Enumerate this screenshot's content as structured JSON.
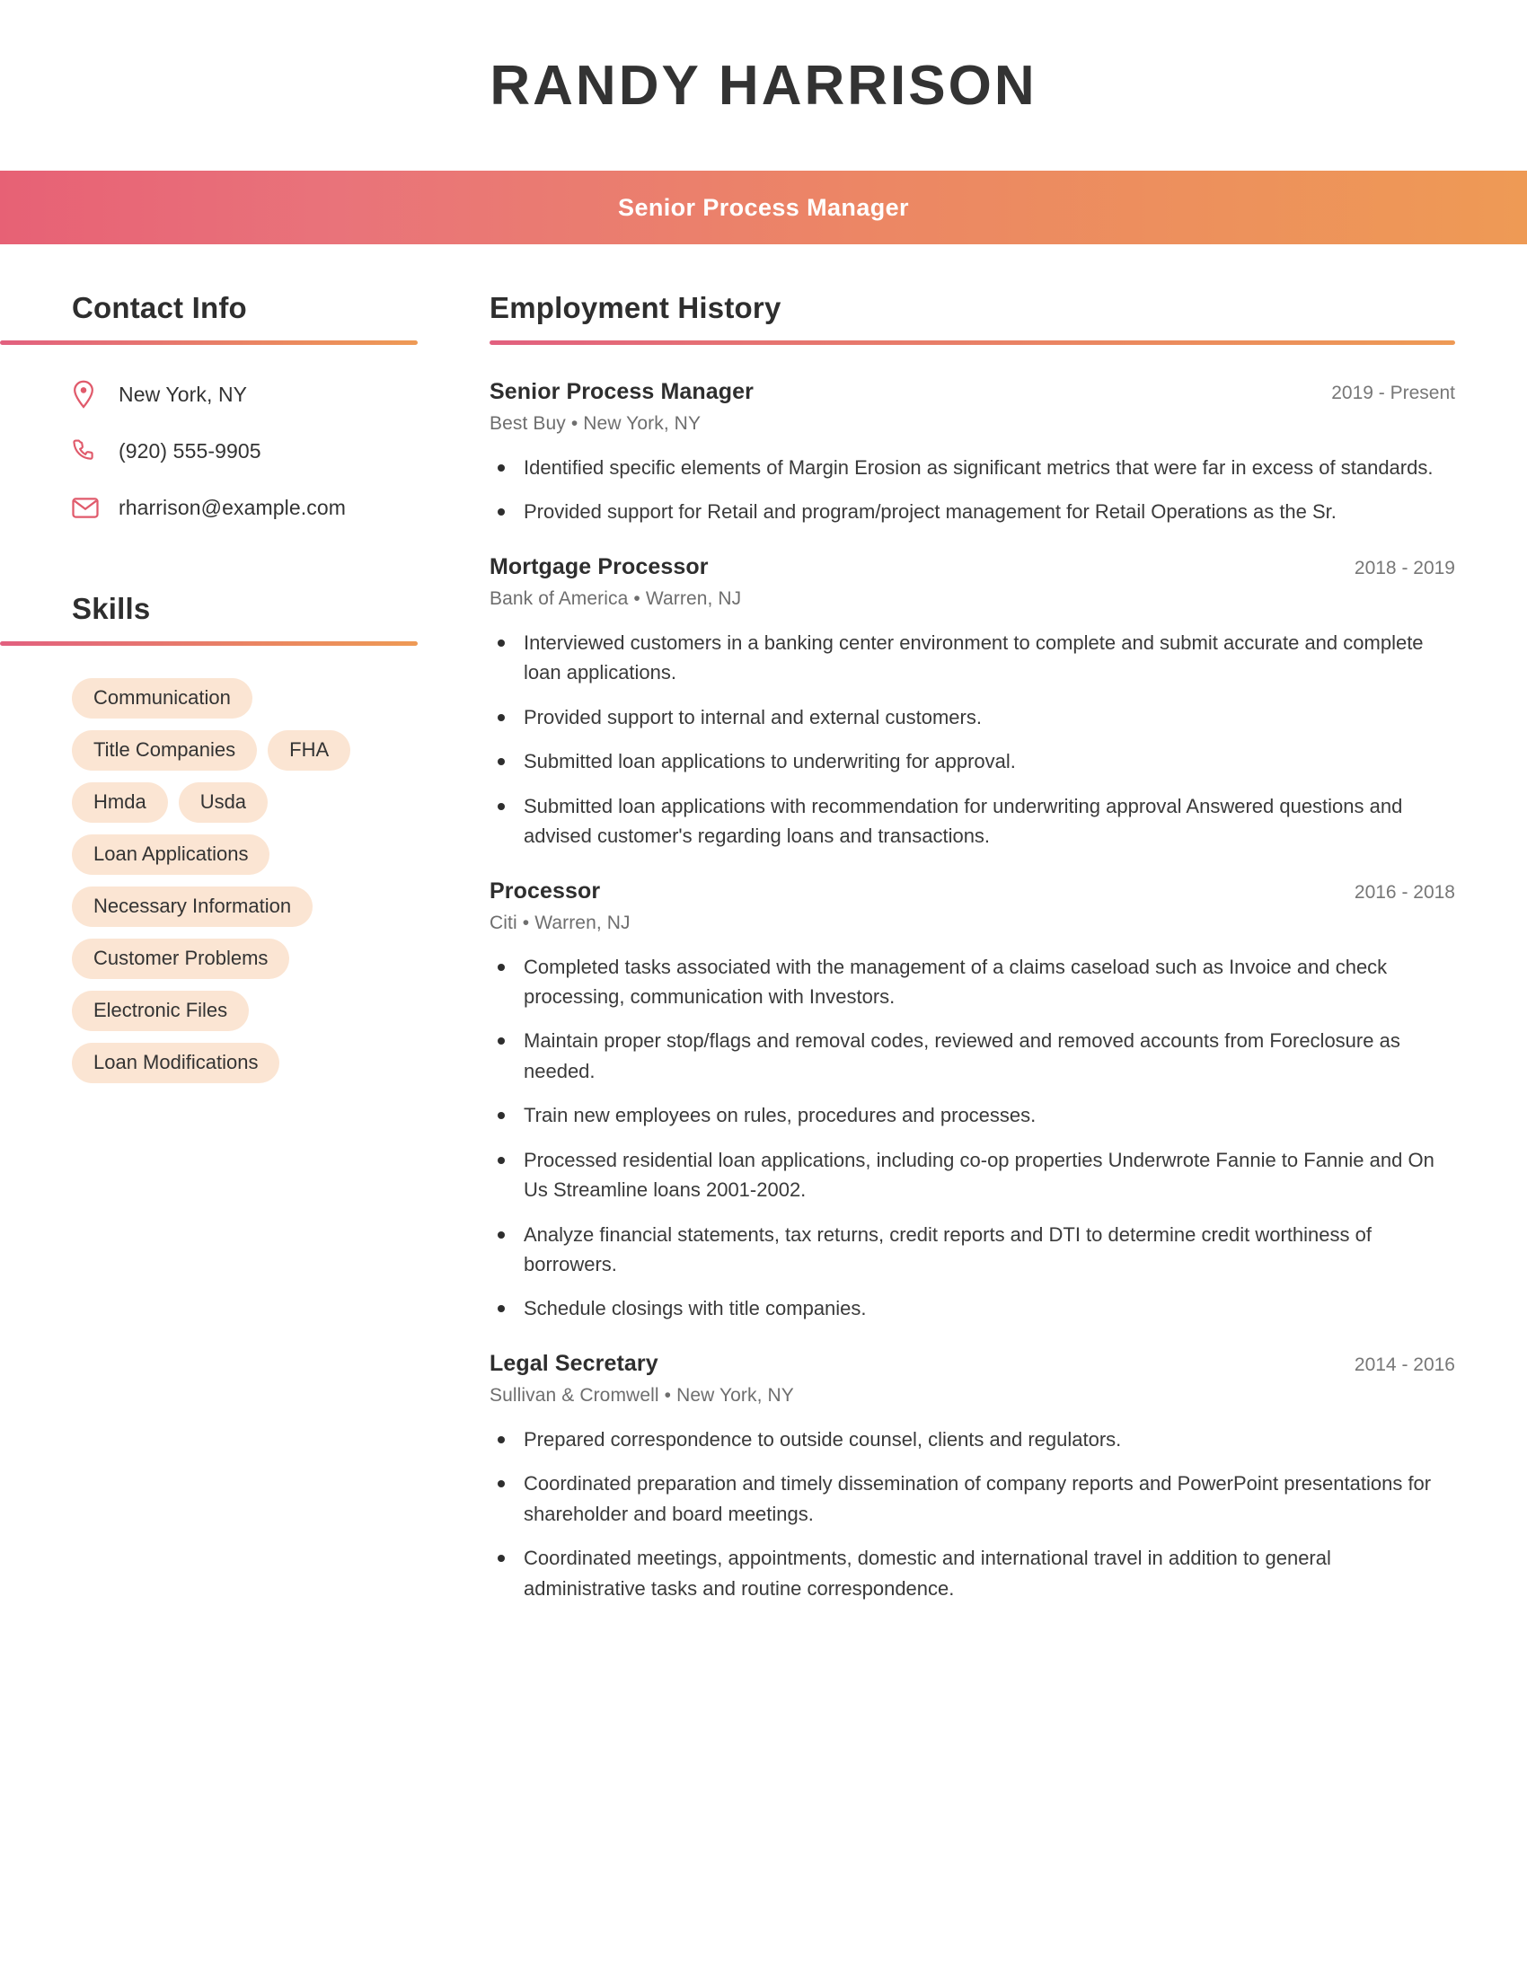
{
  "header": {
    "name": "RANDY HARRISON",
    "job_title": "Senior Process Manager",
    "gradient_start": "#E76175",
    "gradient_end": "#EE9A55"
  },
  "sidebar": {
    "contact": {
      "heading": "Contact Info",
      "items": [
        {
          "icon": "location-pin-icon",
          "value": "New York, NY"
        },
        {
          "icon": "phone-icon",
          "value": "(920) 555-9905"
        },
        {
          "icon": "envelope-icon",
          "value": "rharrison@example.com"
        }
      ]
    },
    "skills": {
      "heading": "Skills",
      "pill_background": "#FBE5D3",
      "items": [
        "Communication",
        "Title Companies",
        "FHA",
        "Hmda",
        "Usda",
        "Loan Applications",
        "Necessary Information",
        "Customer Problems",
        "Electronic Files",
        "Loan Modifications"
      ]
    }
  },
  "main": {
    "heading": "Employment History",
    "jobs": [
      {
        "title": "Senior Process Manager",
        "dates": "2019 - Present",
        "company": "Best Buy",
        "location": "New York, NY",
        "bullets": [
          "Identified specific elements of Margin Erosion as significant metrics that were far in excess of standards.",
          "Provided support for Retail and program/project management for Retail Operations as the Sr."
        ]
      },
      {
        "title": "Mortgage Processor",
        "dates": "2018 - 2019",
        "company": "Bank of America",
        "location": "Warren, NJ",
        "bullets": [
          "Interviewed customers in a banking center environment to complete and submit accurate and complete loan applications.",
          "Provided support to internal and external customers.",
          "Submitted loan applications to underwriting for approval.",
          "Submitted loan applications with recommendation for underwriting approval Answered questions and advised customer's regarding loans and transactions."
        ]
      },
      {
        "title": "Processor",
        "dates": "2016 - 2018",
        "company": "Citi",
        "location": "Warren, NJ",
        "bullets": [
          "Completed tasks associated with the management of a claims caseload such as Invoice and check processing, communication with Investors.",
          "Maintain proper stop/flags and removal codes, reviewed and removed accounts from Foreclosure as needed.",
          "Train new employees on rules, procedures and processes.",
          "Processed residential loan applications, including co-op properties Underwrote Fannie to Fannie and On Us Streamline loans 2001-2002.",
          "Analyze financial statements, tax returns, credit reports and DTI to determine credit worthiness of borrowers.",
          "Schedule closings with title companies."
        ]
      },
      {
        "title": "Legal Secretary",
        "dates": "2014 - 2016",
        "company": "Sullivan & Cromwell",
        "location": "New York, NY",
        "bullets": [
          "Prepared correspondence to outside counsel, clients and regulators.",
          "Coordinated preparation and timely dissemination of company reports and PowerPoint presentations for shareholder and board meetings.",
          "Coordinated meetings, appointments, domestic and international travel in addition to general administrative tasks and routine correspondence."
        ]
      }
    ],
    "separator": "•"
  }
}
